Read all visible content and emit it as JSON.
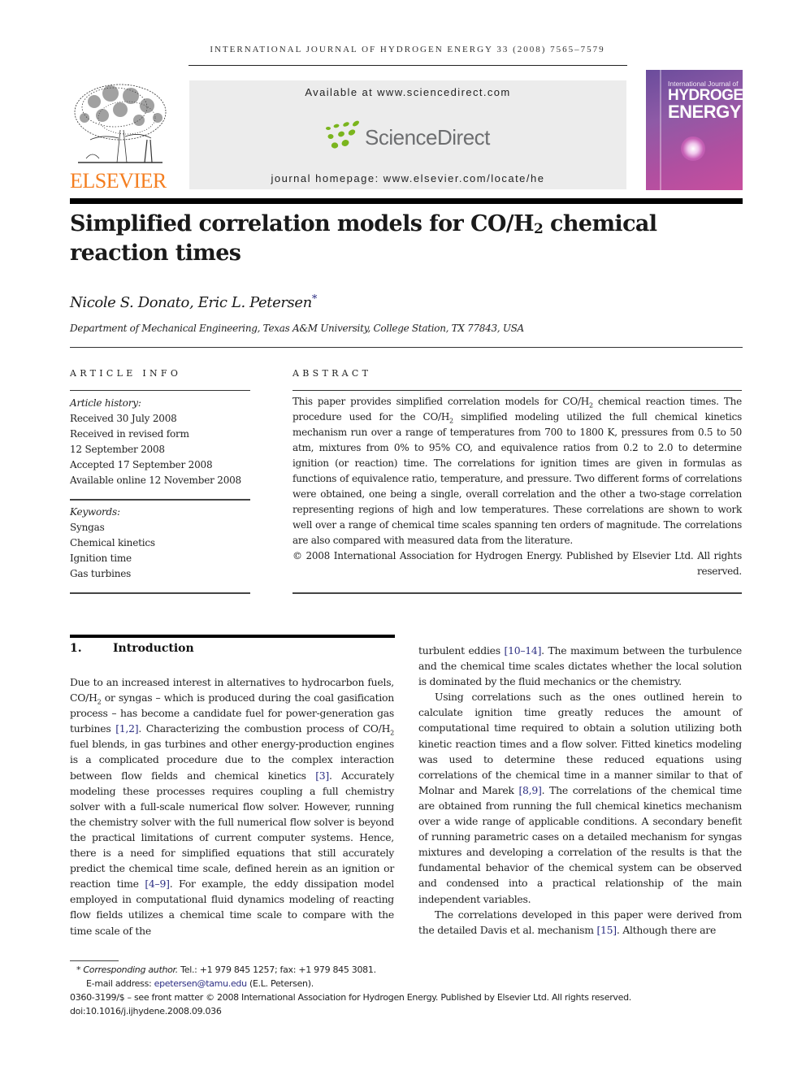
{
  "running_head": "INTERNATIONAL JOURNAL OF HYDROGEN ENERGY 33 (2008) 7565–7579",
  "header": {
    "publisher_logo_text": "ELSEVIER",
    "publisher_logo_color": "#f47e20",
    "available_at": "Available at www.sciencedirect.com",
    "sciencedirect_logo": "ScienceDirect",
    "sciencedirect_green": "#7ab51d",
    "journal_homepage": "journal homepage: www.elsevier.com/locate/he",
    "cover": {
      "line1": "International Journal of",
      "line2": "HYDROGEN",
      "line3": "ENERGY"
    }
  },
  "article": {
    "title_part1": "Simplified correlation models for CO/H",
    "title_sub": "2",
    "title_part2": " chemical reaction times",
    "authors": "Nicole S. Donato, Eric L. Petersen",
    "author_mark": "*",
    "affiliation": "Department of Mechanical Engineering, Texas A&M University, College Station, TX 77843, USA"
  },
  "article_info": {
    "heading": "ARTICLE INFO",
    "history_label": "Article history:",
    "history": [
      "Received 30 July 2008",
      "Received in revised form",
      "12 September 2008",
      "Accepted 17 September 2008",
      "Available online 12 November 2008"
    ],
    "keywords_label": "Keywords:",
    "keywords": [
      "Syngas",
      "Chemical kinetics",
      "Ignition time",
      "Gas turbines"
    ]
  },
  "abstract": {
    "heading": "ABSTRACT",
    "s1a": "This paper provides simplified correlation models for CO/H",
    "s1b": " chemical reaction times. The procedure used for the CO/H",
    "s1c": " simplified modeling utilized the full chemical kinetics mechanism run over a range of temperatures from 700 to 1800 K, pressures from 0.5 to 50 atm, mixtures from 0% to 95% CO, and equivalence ratios from 0.2 to 2.0 to determine ignition (or reaction) time. The correlations for ignition times are given in formulas as functions of equivalence ratio, temperature, and pressure. Two different forms of correlations were obtained, one being a single, overall correlation and the other a two-stage correlation representing regions of high and low temperatures. These correlations are shown to work well over a range of chemical time scales spanning ten orders of magnitude. The correlations are also compared with measured data from the literature.",
    "sub": "2",
    "copyright": "© 2008 International Association for Hydrogen Energy. Published by Elsevier Ltd. All rights reserved."
  },
  "introduction": {
    "number": "1.",
    "heading": "Introduction",
    "left": {
      "t1": "Due to an increased interest in alternatives to hydrocarbon fuels, CO/H",
      "t2": " or syngas – which is produced during the coal gasification process – has become a candidate fuel for power-generation gas turbines ",
      "r1": "[1,2]",
      "t3": ". Characterizing the combustion process of CO/H",
      "t4": " fuel blends, in gas turbines and other energy-production engines is a complicated procedure due to the complex interaction between flow fields and chemical kinetics ",
      "r2": "[3]",
      "t5": ". Accurately modeling these processes requires coupling a full chemistry solver with a full-scale numerical flow solver. However, running the chemistry solver with the full numerical flow solver is beyond the practical limitations of current computer systems. Hence, there is a need for simplified equations that still accurately predict the chemical time scale, defined herein as an ignition or reaction time ",
      "r3": "[4–9]",
      "t6": ". For example, the eddy dissipation model employed in computational fluid dynamics modeling of reacting flow fields utilizes a chemical time scale to compare with the time scale of the"
    },
    "right": {
      "p1a": "turbulent eddies ",
      "r1": "[10–14]",
      "p1b": ". The maximum between the turbulence and the chemical time scales dictates whether the local solution is dominated by the fluid mechanics or the chemistry.",
      "p2a": "Using correlations such as the ones outlined herein to calculate ignition time greatly reduces the amount of computational time required to obtain a solution utilizing both kinetic reaction times and a flow solver. Fitted kinetics modeling was used to determine these reduced equations using correlations of the chemical time in a manner similar to that of Molnar and Marek ",
      "r2": "[8,9]",
      "p2b": ". The correlations of the chemical time are obtained from running the full chemical kinetics mechanism over a wide range of applicable conditions. A secondary benefit of running parametric cases on a detailed mechanism for syngas mixtures and developing a correlation of the results is that the fundamental behavior of the chemical system can be observed and condensed into a practical relationship of the main independent variables.",
      "p3a": "The correlations developed in this paper were derived from the detailed Davis et al. mechanism ",
      "r3": "[15]",
      "p3b": ". Although there are"
    }
  },
  "footnotes": {
    "star": "*",
    "corresponding_label": "Corresponding author.",
    "contact": " Tel.: +1 979 845 1257; fax: +1 979 845 3081.",
    "email_label": "E-mail address: ",
    "email": "epetersen@tamu.edu",
    "email_suffix": " (E.L. Petersen).",
    "front_matter": "0360-3199/$ – see front matter © 2008 International Association for Hydrogen Energy. Published by Elsevier Ltd. All rights reserved.",
    "doi": "doi:10.1016/j.ijhydene.2008.09.036"
  },
  "colors": {
    "reference_link": "#2c2e83"
  }
}
